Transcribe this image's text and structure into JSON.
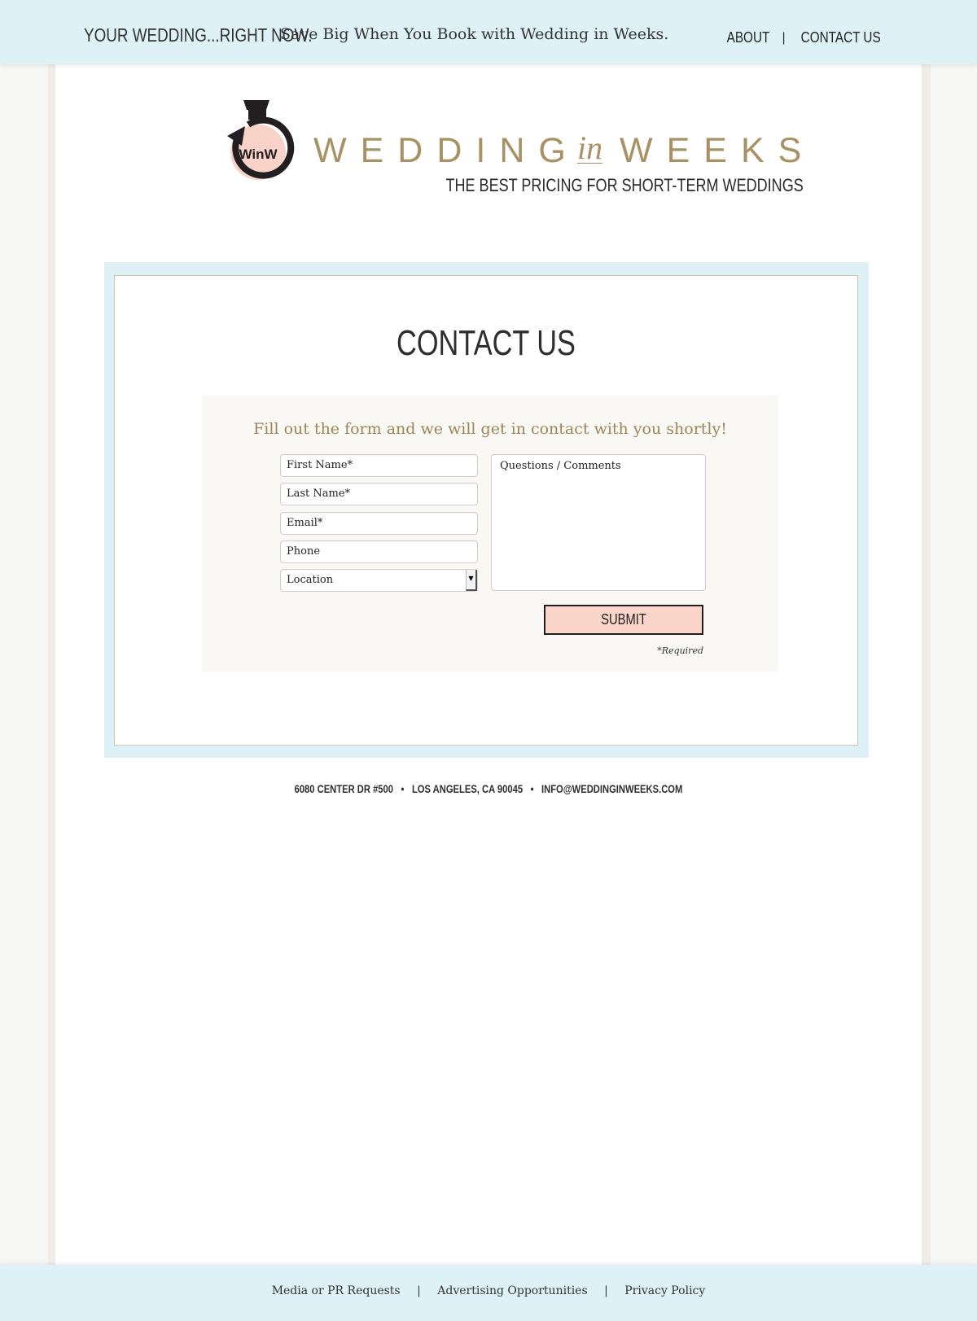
{
  "topbar": {
    "tagline_bold": "YOUR WEDDING...RIGHT NOW.",
    "tagline_text": "Save Big When You Book with Wedding in Weeks.",
    "nav": [
      {
        "label": "ABOUT"
      },
      {
        "label": "CONTACT US"
      }
    ],
    "nav_separator": "|"
  },
  "logo": {
    "monogram": "WinW",
    "word1": "WEDDING",
    "word_in": "in",
    "word2": "WEEKS",
    "subtitle": "THE BEST PRICING FOR SHORT-TERM WEDDINGS",
    "colors": {
      "gold": "#a89164",
      "ring": "#231f20",
      "blush": "#f9d3c8"
    }
  },
  "contact": {
    "title": "CONTACT US",
    "intro": "Fill out the form and we will get in contact with you shortly!",
    "fields": {
      "first_name": "First Name*",
      "last_name": "Last Name*",
      "email": "Email*",
      "phone": "Phone",
      "location": "Location",
      "comments": "Questions / Comments"
    },
    "submit_label": "SUBMIT",
    "required_note": "*Required"
  },
  "address": {
    "street": "6080 CENTER DR #500",
    "city": "LOS ANGELES, CA 90045",
    "email": "INFO@WEDDINGINWEEKS.COM",
    "separator": "•"
  },
  "footer": {
    "links": [
      {
        "label": "Media or PR Requests"
      },
      {
        "label": "Advertising Opportunities"
      },
      {
        "label": "Privacy Policy"
      }
    ],
    "separator": "|"
  },
  "colors": {
    "accent_blue": "#def1f6",
    "submit_pink": "#fbd4ca",
    "gold_text": "#9c8557"
  }
}
